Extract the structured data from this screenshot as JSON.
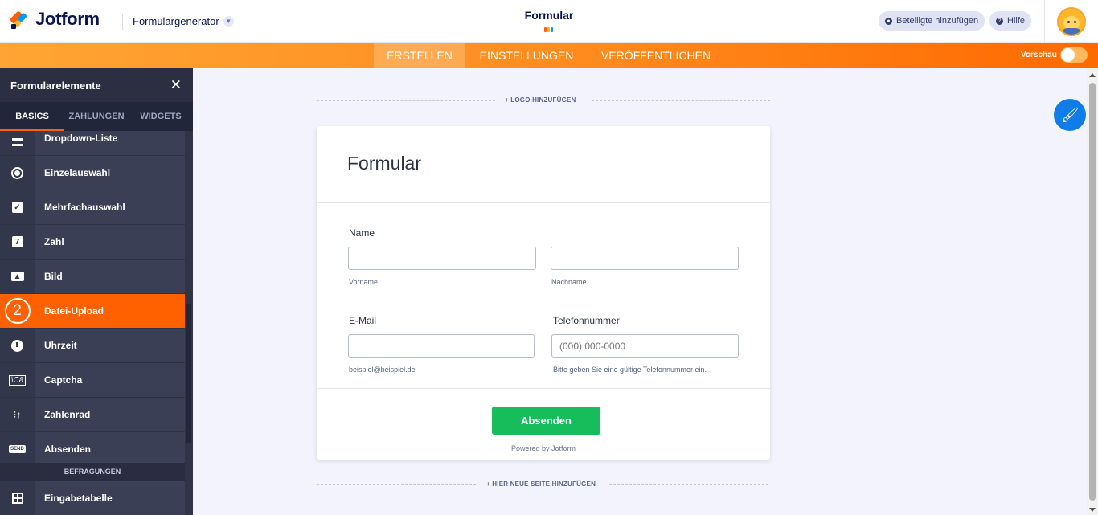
{
  "header": {
    "brand": "Jotform",
    "builder_menu": "Formulargenerator",
    "form_name": "Formular",
    "participants_button": "Beteiligte hinzufügen",
    "help_button": "Hilfe"
  },
  "nav": {
    "tabs": [
      {
        "label": "ERSTELLEN",
        "active": true
      },
      {
        "label": "EINSTELLUNGEN",
        "active": false
      },
      {
        "label": "VERÖFFENTLICHEN",
        "active": false
      }
    ],
    "preview_label": "Vorschau",
    "preview_enabled": false
  },
  "sidebar": {
    "title": "Formularelemente",
    "tabs": [
      {
        "label": "BASICS",
        "active": true
      },
      {
        "label": "ZAHLUNGEN",
        "active": false
      },
      {
        "label": "WIDGETS",
        "active": false
      }
    ],
    "items": [
      {
        "label": "Dropdown-Liste",
        "icon": "dropdown-icon"
      },
      {
        "label": "Einzelauswahl",
        "icon": "radio-icon"
      },
      {
        "label": "Mehrfachauswahl",
        "icon": "checkbox-icon"
      },
      {
        "label": "Zahl",
        "icon": "number-icon",
        "glyph": "7"
      },
      {
        "label": "Bild",
        "icon": "image-icon"
      },
      {
        "label": "Datei-Upload",
        "icon": "step-number-badge",
        "badge": "2",
        "active": true
      },
      {
        "label": "Uhrzeit",
        "icon": "clock-icon"
      },
      {
        "label": "Captcha",
        "icon": "captcha-icon"
      },
      {
        "label": "Zahlenrad",
        "icon": "spinner-icon"
      },
      {
        "label": "Absenden",
        "icon": "send-icon",
        "glyph": "SEND"
      }
    ],
    "group_label": "BEFRAGUNGEN",
    "group_items": [
      {
        "label": "Eingabetabelle",
        "icon": "table-icon"
      }
    ]
  },
  "canvas": {
    "add_logo": "+ LOGO HINZUFÜGEN",
    "add_page": "+ HIER NEUE SEITE HINZUFÜGEN"
  },
  "form": {
    "title": "Formular",
    "name_label": "Name",
    "first_name_value": "",
    "first_name_sublabel": "Vorname",
    "last_name_value": "",
    "last_name_sublabel": "Nachname",
    "email_label": "E-Mail",
    "email_value": "",
    "email_sublabel": "beispiel@beispiel.de",
    "phone_label": "Telefonnummer",
    "phone_placeholder": "(000) 000-0000",
    "phone_sublabel": "Bitte geben Sie eine gültige Telefonnummer ein.",
    "submit_label": "Absenden",
    "powered_by": "Powered by Jotform"
  },
  "colors": {
    "accent": "#ff6100",
    "submit": "#18bd5b",
    "fab": "#0f7ce8",
    "sidebar_bg": "#303446"
  }
}
